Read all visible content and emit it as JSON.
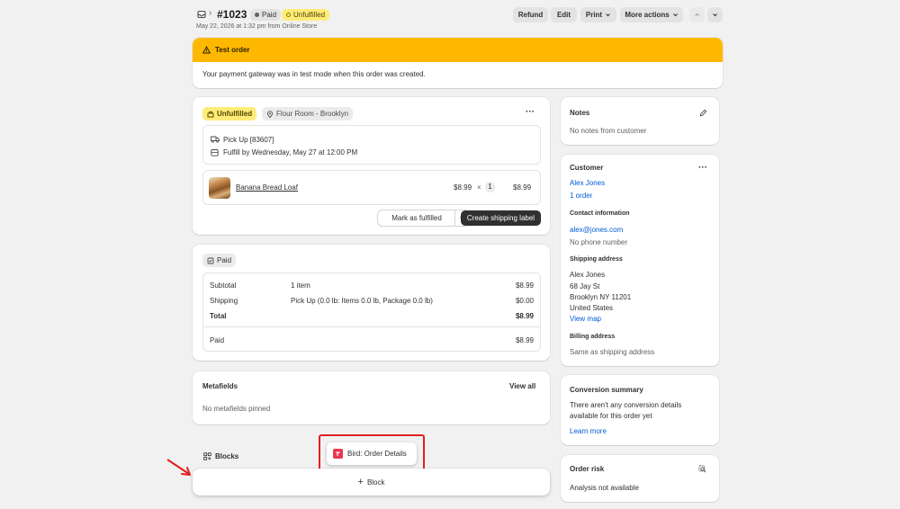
{
  "header": {
    "order_number": "#1023",
    "paid_badge": "Paid",
    "unfulfilled_badge": "Unfulfilled",
    "subtitle": "May 22, 2026 at 1:32 pm from Online Store",
    "refund": "Refund",
    "edit": "Edit",
    "print": "Print",
    "more_actions": "More actions"
  },
  "banner": {
    "title": "Test order",
    "message": "Your payment gateway was in test mode when this order was created."
  },
  "fulfillment": {
    "status": "Unfulfilled",
    "location": "Flour Room - Brooklyn",
    "pickup": "Pick Up [83607]",
    "fulfill_by": "Fulfill by Wednesday, May 27 at 12:00 PM",
    "product_name": "Banana Bread Loaf",
    "unit_price": "$8.99",
    "times": "×",
    "quantity": "1",
    "line_total": "$8.99",
    "mark_fulfilled": "Mark as fulfilled",
    "create_label": "Create shipping label"
  },
  "payment": {
    "status": "Paid",
    "rows": [
      {
        "label": "Subtotal",
        "detail": "1 item",
        "amount": "$8.99"
      },
      {
        "label": "Shipping",
        "detail": "Pick Up (0.0 lb: Items 0.0 lb, Package 0.0 lb)",
        "amount": "$0.00"
      },
      {
        "label": "Total",
        "detail": "",
        "amount": "$8.99"
      }
    ],
    "paid_label": "Paid",
    "paid_amount": "$8.99"
  },
  "metafields": {
    "title": "Metafields",
    "view_all": "View all",
    "empty": "No metafields pinned"
  },
  "blocks": {
    "title": "Blocks",
    "bird_label": "Bird: Order Details",
    "add_block": "Block"
  },
  "notes": {
    "title": "Notes",
    "empty": "No notes from customer"
  },
  "customer": {
    "title": "Customer",
    "name": "Alex Jones",
    "orders": "1 order",
    "contact_title": "Contact information",
    "email": "alex@jones.com",
    "phone": "No phone number",
    "shipping_title": "Shipping address",
    "address": [
      "Alex Jones",
      "68 Jay St",
      "Brooklyn NY 11201",
      "United States"
    ],
    "view_map": "View map",
    "billing_title": "Billing address",
    "billing": "Same as shipping address"
  },
  "conversion": {
    "title": "Conversion summary",
    "text1": "There aren't any conversion details",
    "text2": "available for this order yet",
    "learn_more": "Learn more"
  },
  "risk": {
    "title": "Order risk",
    "text": "Analysis not available"
  },
  "colors": {
    "banner": "#ffb800",
    "unfulfilled_badge": "#ffeb78",
    "annotation_red": "#e02020",
    "link": "#005bd3"
  }
}
